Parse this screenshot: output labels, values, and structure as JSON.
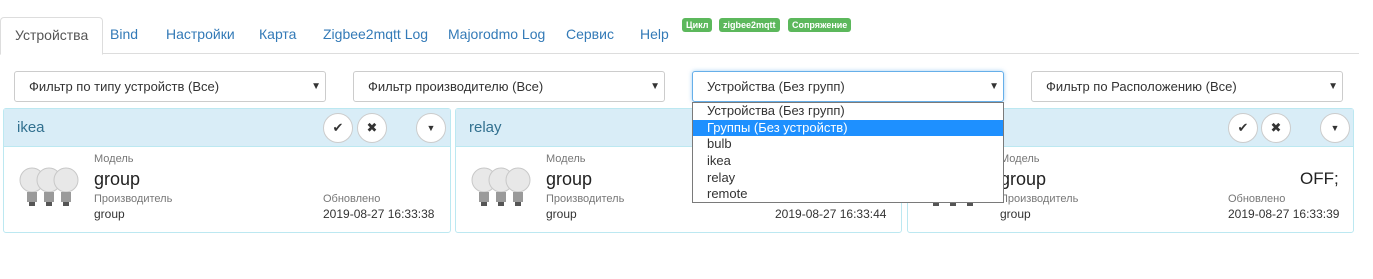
{
  "tabs": [
    {
      "label": "Устройства",
      "active": true
    },
    {
      "label": "Bind"
    },
    {
      "label": "Настройки"
    },
    {
      "label": "Карта"
    },
    {
      "label": "Zigbee2mqtt Log"
    },
    {
      "label": "Majorodmo Log"
    },
    {
      "label": "Сервис"
    },
    {
      "label": "Help"
    }
  ],
  "badges": [
    "Цикл",
    "zigbee2mqtt",
    "Сопряжение"
  ],
  "colors": {
    "badge": "#5cb85c",
    "link": "#337ab7",
    "panel_head": "#d9edf7",
    "dropdown_highlight": "#1e90ff"
  },
  "filters": {
    "type": "Фильтр по типу устройств (Все)",
    "manufacturer": "Фильтр производителю (Все)",
    "groups": "Устройства (Без групп)",
    "location": "Фильтр по Расположению (Все)"
  },
  "groups_dropdown": {
    "options": [
      "Устройства (Без групп)",
      "Группы (Без устройств)",
      "bulb",
      "ikea",
      "relay",
      "remote"
    ],
    "highlighted": "Группы (Без устройств)"
  },
  "icons": {
    "check": "check-icon",
    "close": "close-icon",
    "caret": "caret-down-icon",
    "device": "bulbs-icon"
  },
  "labels": {
    "model": "Модель",
    "manufacturer": "Производитель",
    "updated": "Обновлено"
  },
  "devices": [
    {
      "title": "ikea",
      "model": "group",
      "manufacturer": "group",
      "updated": "2019-08-27 16:33:38",
      "state": ""
    },
    {
      "title": "relay",
      "model": "group",
      "manufacturer": "group",
      "updated": "2019-08-27 16:33:44",
      "state": ""
    },
    {
      "title": "",
      "model": "group",
      "manufacturer": "group",
      "updated": "2019-08-27 16:33:39",
      "state": "OFF;"
    }
  ]
}
